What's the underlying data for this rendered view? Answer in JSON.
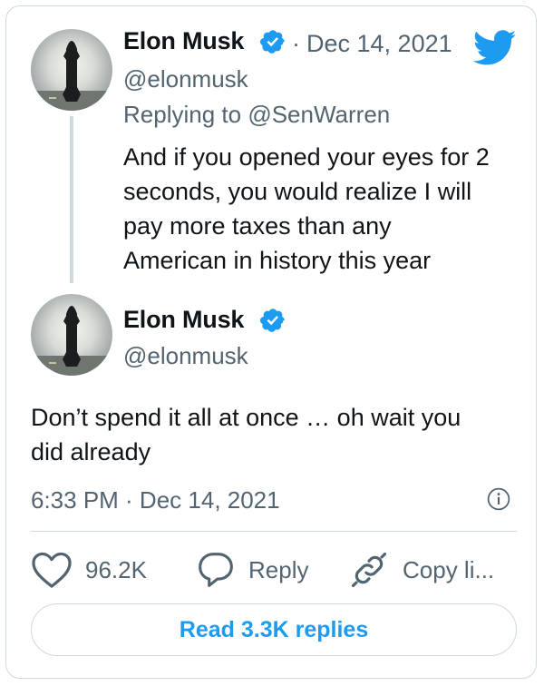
{
  "colors": {
    "brand_blue": "#1d9bf0",
    "secondary_text": "#536471",
    "border": "#cfd9de"
  },
  "parent_tweet": {
    "author_name": "Elon Musk",
    "separator": "·",
    "date": "Dec 14, 2021",
    "handle": "@elonmusk",
    "replying_prefix": "Replying to",
    "replying_to": "@SenWarren",
    "text_lines": [
      "And if you opened your eyes for 2",
      "seconds, you would realize I will",
      "pay more taxes than any",
      "American in history this year"
    ]
  },
  "main_tweet": {
    "author_name": "Elon Musk",
    "handle": "@elonmusk",
    "text_lines": [
      "Don’t spend it all at once … oh wait you",
      "did already"
    ],
    "timestamp": "6:33 PM · Dec 14, 2021"
  },
  "actions": {
    "like_count": "96.2K",
    "reply_label": "Reply",
    "copy_label": "Copy li..."
  },
  "read_replies_label": "Read 3.3K replies",
  "icons": [
    "twitter-bird-icon",
    "verified-badge-icon",
    "heart-icon",
    "speech-bubble-icon",
    "link-icon",
    "info-icon"
  ]
}
